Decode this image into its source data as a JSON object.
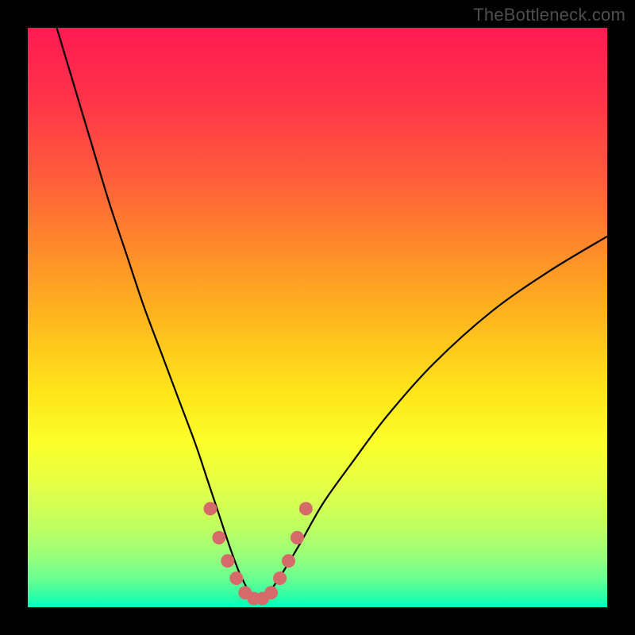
{
  "watermark": "TheBottleneck.com",
  "chart_data": {
    "type": "line",
    "title": "",
    "xlabel": "",
    "ylabel": "",
    "xlim": [
      0,
      100
    ],
    "ylim": [
      0,
      100
    ],
    "background_gradient": {
      "stops": [
        {
          "pos": 0.0,
          "color": "#ff1a52"
        },
        {
          "pos": 0.12,
          "color": "#ff3249"
        },
        {
          "pos": 0.25,
          "color": "#ff5a3c"
        },
        {
          "pos": 0.38,
          "color": "#ff8a2a"
        },
        {
          "pos": 0.5,
          "color": "#ffb61e"
        },
        {
          "pos": 0.62,
          "color": "#ffe21a"
        },
        {
          "pos": 0.72,
          "color": "#fbff2a"
        },
        {
          "pos": 0.8,
          "color": "#e0ff4a"
        },
        {
          "pos": 0.86,
          "color": "#c0ff60"
        },
        {
          "pos": 0.91,
          "color": "#9aff7a"
        },
        {
          "pos": 0.95,
          "color": "#6aff90"
        },
        {
          "pos": 0.98,
          "color": "#30ffa6"
        },
        {
          "pos": 1.0,
          "color": "#00ffc0"
        }
      ]
    },
    "series": [
      {
        "name": "bottleneck-curve",
        "color": "#000000",
        "x": [
          5,
          8,
          11,
          14,
          17,
          20,
          23,
          26,
          29,
          31,
          33,
          35,
          36.5,
          38,
          39,
          40,
          41,
          42,
          44,
          47,
          51,
          56,
          62,
          70,
          80,
          90,
          100
        ],
        "y": [
          100,
          90,
          80,
          70,
          61,
          52,
          44,
          36,
          28,
          22,
          16,
          10,
          6,
          3,
          1.5,
          1,
          1.5,
          3,
          6,
          11,
          18,
          25,
          33,
          42,
          51,
          58,
          64
        ]
      },
      {
        "name": "highlight-markers",
        "type": "scatter",
        "color": "#d66a6a",
        "x": [
          31.5,
          33,
          34.5,
          36,
          37.5,
          39,
          40.5,
          42,
          43.5,
          45,
          46.5,
          48
        ],
        "y": [
          17,
          12,
          8,
          5,
          2.5,
          1.5,
          1.5,
          2.5,
          5,
          8,
          12,
          17
        ]
      }
    ],
    "annotations": []
  }
}
